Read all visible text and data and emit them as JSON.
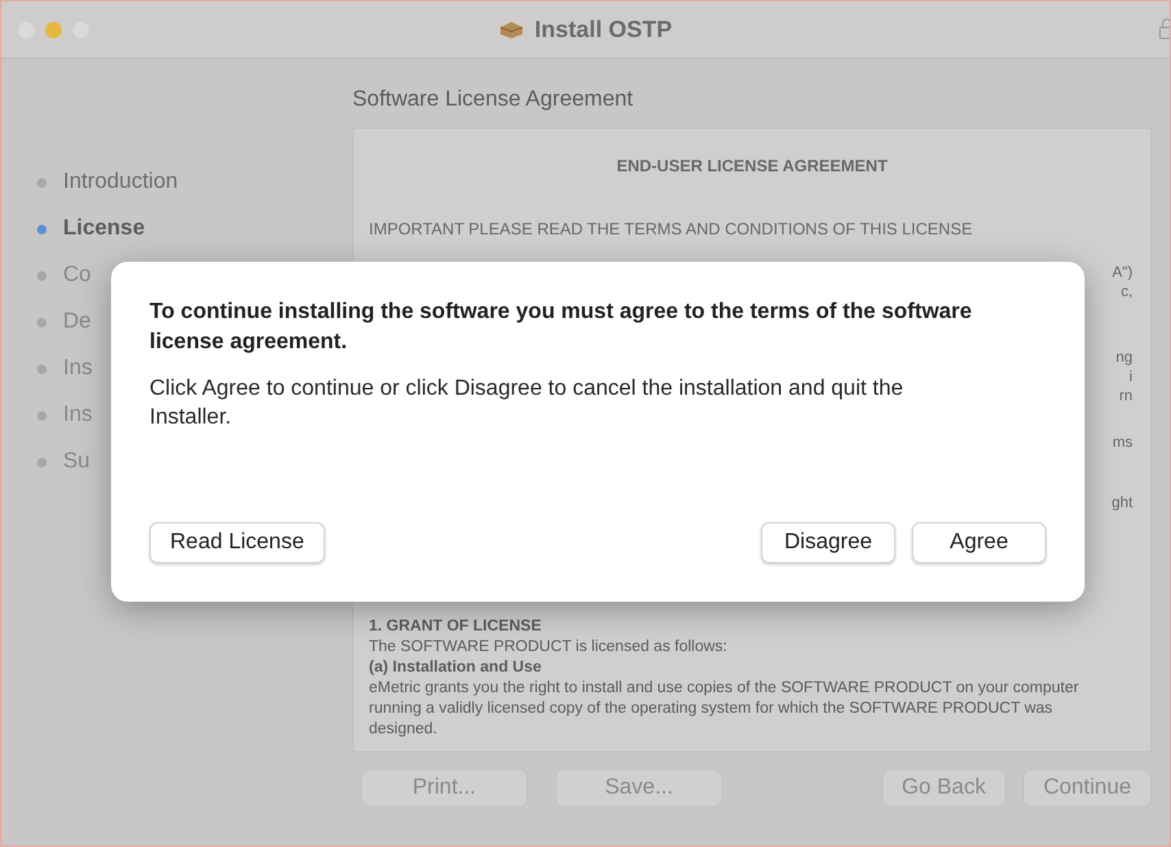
{
  "window": {
    "title": "Install OSTP"
  },
  "heading": "Software License Agreement",
  "sidebar": {
    "items": [
      {
        "label": "Introduction",
        "selected": false
      },
      {
        "label": "License",
        "selected": true
      },
      {
        "label": "Co",
        "selected": false
      },
      {
        "label": "De",
        "selected": false
      },
      {
        "label": "Ins",
        "selected": false
      },
      {
        "label": "Ins",
        "selected": false
      },
      {
        "label": "Su",
        "selected": false
      }
    ]
  },
  "license": {
    "title": "END-USER LICENSE AGREEMENT",
    "intro": "IMPORTANT PLEASE READ THE TERMS AND CONDITIONS OF THIS LICENSE",
    "fragments": [
      "A\")",
      "c,",
      "ng",
      "i",
      "rn",
      "ms",
      "ght"
    ],
    "sections": [
      {
        "kind": "heading",
        "text": "1. GRANT OF LICENSE"
      },
      {
        "kind": "text",
        "text": "The SOFTWARE PRODUCT is licensed as follows:"
      },
      {
        "kind": "heading",
        "text": "(a) Installation and Use"
      },
      {
        "kind": "text",
        "text": "eMetric grants you the right to install and use copies of the SOFTWARE PRODUCT on your computer running a validly licensed copy of the operating system for which the SOFTWARE PRODUCT was designed."
      }
    ]
  },
  "buttons": {
    "left": [
      "Print...",
      "Save..."
    ],
    "right": [
      "Go Back",
      "Continue"
    ]
  },
  "dialog": {
    "title": "To continue installing the software you must agree to the terms of the software license agreement.",
    "message": "Click Agree to continue or click Disagree to cancel the installation and quit the Installer.",
    "buttons": {
      "left": [
        "Read License"
      ],
      "right": [
        "Disagree",
        "Agree"
      ]
    }
  }
}
